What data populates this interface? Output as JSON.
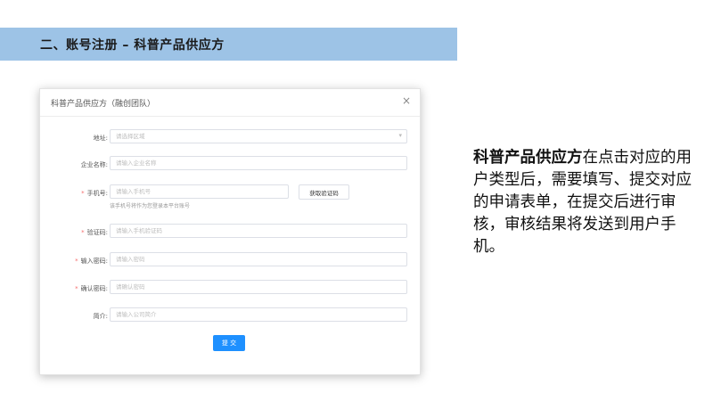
{
  "banner": {
    "title": "二、账号注册  –  科普产品供应方"
  },
  "dialog": {
    "title": "科普产品供应方（融创团队）",
    "close_symbol": "×",
    "fields": {
      "region": {
        "label": "地址:",
        "placeholder": "请选择区域",
        "required": false
      },
      "company": {
        "label": "企业名称:",
        "placeholder": "请输入企业名称",
        "required": false
      },
      "phone": {
        "label": "手机号:",
        "placeholder": "请输入手机号",
        "required": true,
        "hint": "该手机号将作为您登录本平台账号"
      },
      "sms_button": "获取验证码",
      "code": {
        "label": "验证码:",
        "placeholder": "请输入手机验证码",
        "required": true
      },
      "password": {
        "label": "输入密码:",
        "placeholder": "请输入密码",
        "required": true
      },
      "confirm": {
        "label": "确认密码:",
        "placeholder": "请确认密码",
        "required": true
      },
      "intro": {
        "label": "简介:",
        "placeholder": "请输入公司简介",
        "required": false
      }
    },
    "submit_label": "提 交",
    "required_mark": "*"
  },
  "description": {
    "emphasis": "科普产品供应方",
    "text": "在点击对应的用户类型后，需要填写、提交对应的申请表单，在提交后进行审核，审核结果将发送到用户手机。"
  },
  "colors": {
    "banner": "#9dc3e6",
    "primary": "#1e90ff",
    "required": "#f56c6c"
  }
}
